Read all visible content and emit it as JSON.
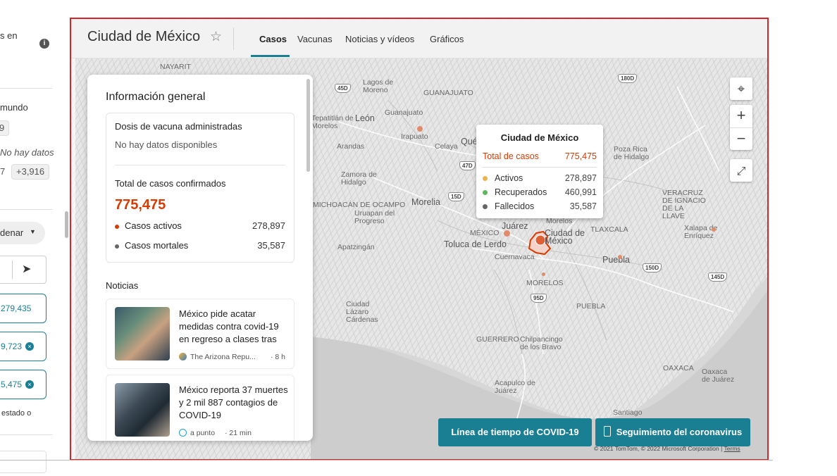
{
  "left_pane": {
    "line1": "s en",
    "info_icon": "info-icon",
    "section_title": "mundo",
    "chip1": "9",
    "no_data": "No hay datos",
    "stat_a": "7",
    "stat_b": "+3,916",
    "sort_label": "denar",
    "filters": [
      "279,435",
      "9,723",
      "5,475"
    ],
    "state_note": "estado o"
  },
  "header": {
    "title": "Ciudad de México",
    "tabs": [
      "Casos",
      "Vacunas",
      "Noticias y vídeos",
      "Gráficos"
    ],
    "active_tab": "Casos"
  },
  "card": {
    "title": "Información general",
    "vaccine_title": "Dosis de vacuna administradas",
    "vaccine_value": "No hay datos disponibles",
    "confirmed_title": "Total de casos confirmados",
    "confirmed_total": "775,475",
    "active_label": "Casos activos",
    "active_value": "278,897",
    "deaths_label": "Casos mortales",
    "deaths_value": "35,587",
    "news_heading": "Noticias",
    "news": [
      {
        "title": "México pide acatar medidas contra covid-19 en regreso a clases tras",
        "source": "The Arizona Repu...",
        "age": "· 8 h"
      },
      {
        "title": "México reporta 37 muertes y 2 mil 887 contagios de COVID-19",
        "source": "a punto",
        "age": "· 21 min"
      }
    ]
  },
  "popup": {
    "title": "Ciudad de México",
    "total_label": "Total de casos",
    "total_value": "775,475",
    "rows": [
      {
        "label": "Activos",
        "value": "278,897"
      },
      {
        "label": "Recuperados",
        "value": "460,991"
      },
      {
        "label": "Fallecidos",
        "value": "35,587"
      }
    ]
  },
  "map_labels": {
    "nayarit": "NAYARIT",
    "lagos": "Lagos de Moreno",
    "guanajuato_state": "GUANAJUATO",
    "guanajuato": "Guanajuato",
    "leon": "León",
    "tepatitlan": "Tepatitlán de Morelos",
    "irapuato": "Irapuato",
    "celaya": "Celaya",
    "que": "Qué",
    "arandas": "Arandas",
    "zamora": "Zamora de Hidalgo",
    "michoacan": "MICHOACÁN DE OCAMPO",
    "morelia": "Morelia",
    "uruapan": "Uruapan del Progreso",
    "apatzingan": "Apatzingán",
    "mexico_state": "MÉXICO",
    "toluca": "Toluca de Lerdo",
    "cuernavaca": "Cuernavaca",
    "morelos": "MORELOS",
    "puebla": "Puebla",
    "puebla_state": "PUEBLA",
    "tlaxcala": "TLAXCALA",
    "poza_rica": "Poza Rica de Hidalgo",
    "veracruz": "VERACRUZ DE IGNACIO DE LA LLAVE",
    "xalapa": "Xalapa de Enríquez",
    "lazaro": "Ciudad Lázaro Cárdenas",
    "guerrero": "GUERRERO",
    "chilpancingo": "Chilpancingo de los Bravo",
    "acapulco": "Acapulco de Juárez",
    "oaxaca_state": "OAXACA",
    "oaxaca": "Oaxaca de Juárez",
    "santiago": "Santiago",
    "juarez_part": "Juárez",
    "cdmx_part": "Ciudad de México",
    "morelos_part": "Morelos"
  },
  "shields": [
    "45D",
    "180D",
    "47D",
    "15D",
    "95D",
    "150D",
    "145D"
  ],
  "buttons": {
    "timeline": "Línea de tiempo de COVID-19",
    "tracker": "Seguimiento del coronavirus"
  },
  "copyright": "© 2021 TomTom, © 2022 Microsoft Corporation",
  "terms": "Terms",
  "colors": {
    "accent": "#1a7f93",
    "cases": "#d83b01",
    "active": "#e9b34e",
    "recovered": "#5cb85c",
    "deaths": "#666666",
    "frame_border": "#d9252a"
  }
}
